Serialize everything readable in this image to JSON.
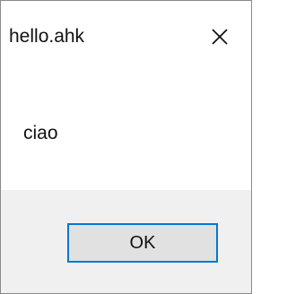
{
  "window": {
    "title": "hello.ahk",
    "close_icon": "close-icon"
  },
  "dialog": {
    "message": "ciao",
    "ok_label": "OK"
  },
  "colors": {
    "accent": "#0078d7",
    "button_bg": "#e1e1e1",
    "footer_bg": "#f0f0f0"
  }
}
